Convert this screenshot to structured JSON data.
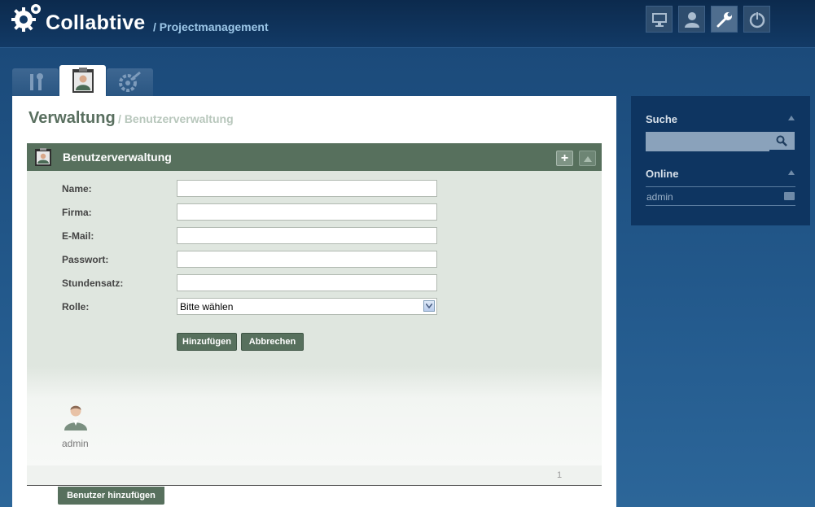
{
  "header": {
    "app_name": "Collabtive",
    "subtitle": "/ Projectmanagement",
    "icons": [
      "desktop-icon",
      "user-icon",
      "wrench-icon",
      "power-icon"
    ]
  },
  "tabs": [
    {
      "icon": "tools-icon",
      "active": false
    },
    {
      "icon": "user-card-icon",
      "active": true
    },
    {
      "icon": "settings-gear-icon",
      "active": false
    }
  ],
  "page": {
    "title": "Verwaltung",
    "subtitle": "/ Benutzerverwaltung"
  },
  "block": {
    "title": "Benutzerverwaltung",
    "add_symbol": "+"
  },
  "form": {
    "name_label": "Name:",
    "company_label": "Firma:",
    "email_label": "E-Mail:",
    "password_label": "Passwort:",
    "rate_label": "Stundensatz:",
    "role_label": "Rolle:",
    "role_selected": "Bitte wählen",
    "name_value": "",
    "company_value": "",
    "email_value": "",
    "password_value": "",
    "rate_value": "",
    "submit_label": "Hinzufügen",
    "cancel_label": "Abbrechen"
  },
  "users": [
    {
      "name": "admin"
    }
  ],
  "pagination": {
    "current_page": "1"
  },
  "add_user_button": "Benutzer hinzufügen",
  "sidebar": {
    "search_title": "Suche",
    "search_value": "",
    "online_title": "Online",
    "online_users": [
      "admin"
    ]
  },
  "colors": {
    "accent_green": "#57705d",
    "header_blue": "#0c2a4d",
    "form_bg": "#dfe6df"
  }
}
